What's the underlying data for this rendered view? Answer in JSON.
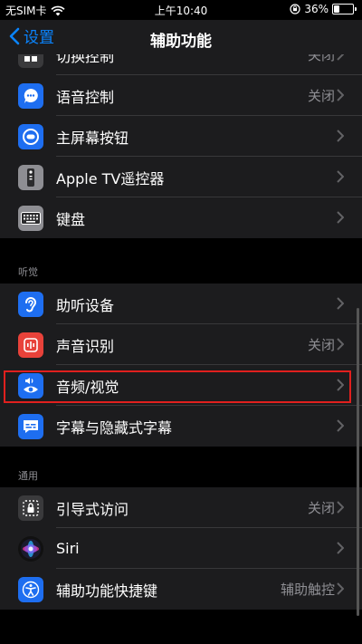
{
  "status_bar": {
    "carrier": "无SIM卡",
    "time": "上午10:40",
    "battery": "36%",
    "battery_level": 0.36
  },
  "nav": {
    "back_label": "设置",
    "title": "辅助功能"
  },
  "colors": {
    "accent": "#0a84ff",
    "highlight": "#e0201e"
  },
  "groups": [
    {
      "header": "",
      "items": [
        {
          "label": "切换控制",
          "value": "关闭",
          "icon": "switch-control-icon",
          "color": "#3a3a3c"
        },
        {
          "label": "语音控制",
          "value": "关闭",
          "icon": "voice-control-icon",
          "color": "#1e6ef0"
        },
        {
          "label": "主屏幕按钮",
          "value": "",
          "icon": "home-button-icon",
          "color": "#1e6ef0"
        },
        {
          "label": "Apple TV遥控器",
          "value": "",
          "icon": "apple-tv-remote-icon",
          "color": "#8e8e93"
        },
        {
          "label": "键盘",
          "value": "",
          "icon": "keyboard-icon",
          "color": "#8e8e93"
        }
      ]
    },
    {
      "header": "听觉",
      "items": [
        {
          "label": "助听设备",
          "value": "",
          "icon": "ear-icon",
          "color": "#1e6ef0"
        },
        {
          "label": "声音识别",
          "value": "关闭",
          "icon": "sound-recognition-icon",
          "color": "#e8423a"
        },
        {
          "label": "音频/视觉",
          "value": "",
          "icon": "audio-visual-icon",
          "color": "#1e6ef0"
        },
        {
          "label": "字幕与隐藏式字幕",
          "value": "",
          "icon": "subtitles-icon",
          "color": "#1e6ef0"
        }
      ]
    },
    {
      "header": "通用",
      "items": [
        {
          "label": "引导式访问",
          "value": "关闭",
          "icon": "guided-access-icon",
          "color": "#3a3a3c"
        },
        {
          "label": "Siri",
          "value": "",
          "icon": "siri-icon",
          "color": "#111"
        },
        {
          "label": "辅助功能快捷键",
          "value": "辅助触控",
          "icon": "accessibility-shortcut-icon",
          "color": "#1e6ef0"
        }
      ]
    }
  ]
}
